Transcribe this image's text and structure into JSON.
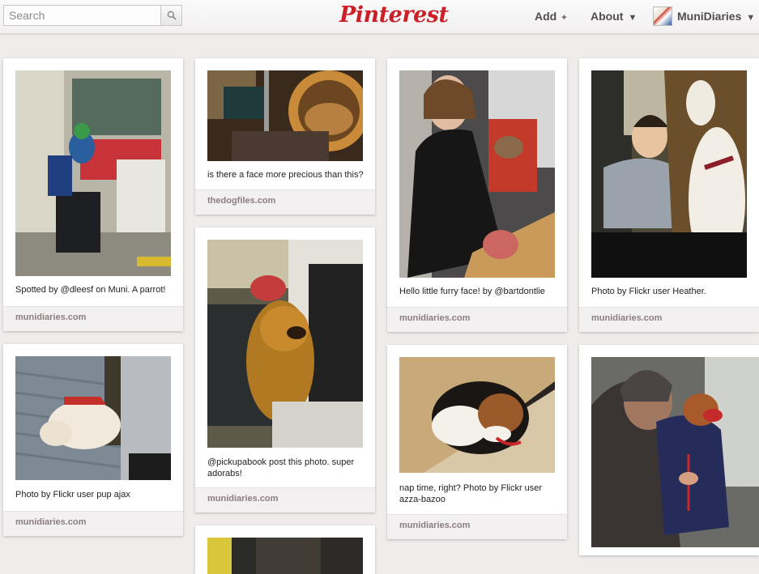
{
  "header": {
    "search": {
      "placeholder": "Search"
    },
    "logo": "Pinterest",
    "nav": {
      "add": "Add",
      "about": "About",
      "user": "MuniDiaries"
    }
  },
  "pins": [
    {
      "description": "Spotted by @dleesf on Muni. A parrot!",
      "source": "munidiaries.com"
    },
    {
      "description": "Photo by Flickr user pup ajax",
      "source": "munidiaries.com"
    },
    {
      "description": "is there a face more precious than this?",
      "source": "thedogfiles.com"
    },
    {
      "description": "@pickupabook post this photo. super adorabs!",
      "source": "munidiaries.com"
    },
    {
      "description": "Hello little furry face! by @bartdontlie",
      "source": "munidiaries.com"
    },
    {
      "description": "nap time, right? Photo by Flickr user azza-bazoo",
      "source": "munidiaries.com"
    },
    {
      "description": "Photo by Flickr user Heather.",
      "source": "munidiaries.com"
    }
  ]
}
